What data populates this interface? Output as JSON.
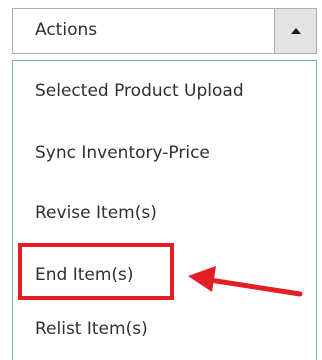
{
  "actions_select": {
    "label": "Actions",
    "caret_icon": "caret-up-icon"
  },
  "menu": {
    "items": [
      {
        "label": "Selected Product Upload"
      },
      {
        "label": "Sync Inventory-Price"
      },
      {
        "label": "Revise Item(s)"
      },
      {
        "label": "End Item(s)"
      },
      {
        "label": "Relist Item(s)"
      }
    ]
  },
  "annotation": {
    "highlight_color": "#e31e24",
    "arrow_icon": "arrow-left-icon"
  }
}
